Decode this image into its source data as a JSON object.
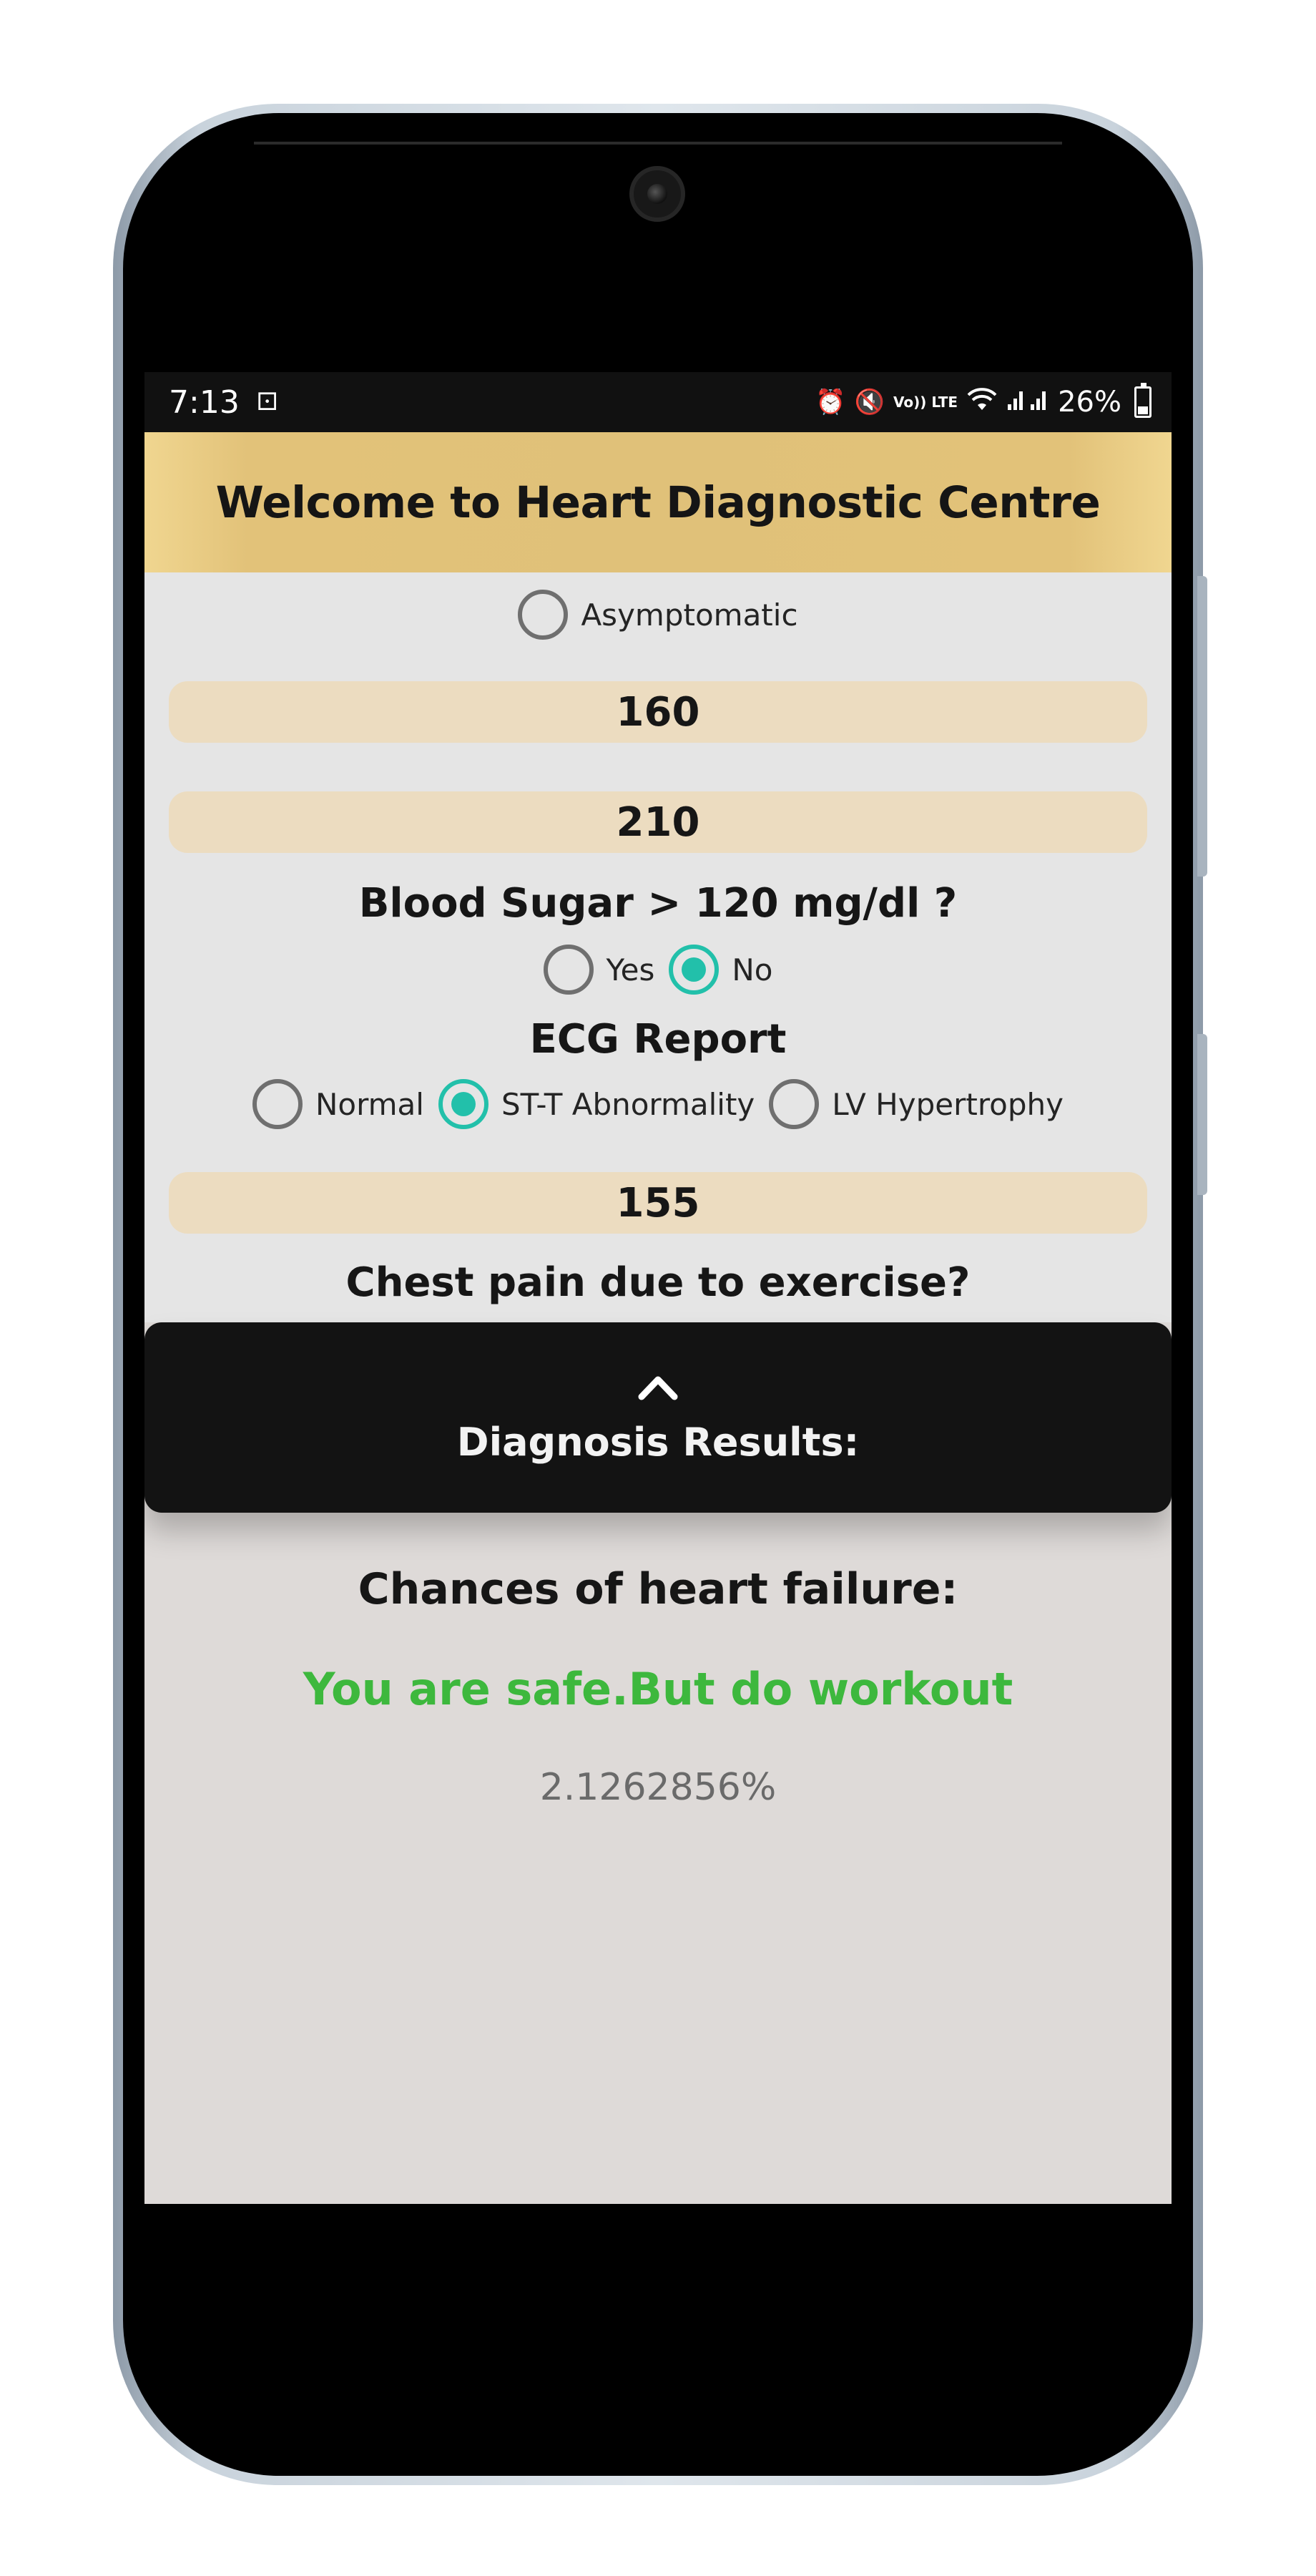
{
  "status_bar": {
    "time": "7:13",
    "battery": "26%",
    "volte": "Vo)) LTE",
    "icons": [
      "link-icon",
      "alarm-icon",
      "mute-icon",
      "wifi-icon",
      "signal-icon",
      "battery-icon"
    ]
  },
  "header": {
    "title": "Welcome to Heart Diagnostic Centre",
    "color": "#e0c179"
  },
  "form": {
    "chest_pain_option": {
      "label": "Asymptomatic",
      "checked": false
    },
    "field_1_value": "160",
    "field_2_value": "210",
    "blood_sugar": {
      "question": "Blood Sugar > 120 mg/dl ?",
      "options": [
        {
          "label": "Yes",
          "checked": false
        },
        {
          "label": "No",
          "checked": true
        }
      ]
    },
    "ecg": {
      "question": "ECG Report",
      "options": [
        {
          "label": "Normal",
          "checked": false
        },
        {
          "label": "ST-T Abnormality",
          "checked": true
        },
        {
          "label": "LV Hypertrophy",
          "checked": false
        }
      ]
    },
    "field_3_value": "155",
    "exercise_question": "Chest pain due to exercise?"
  },
  "results": {
    "sheet_title": "Diagnosis Results:",
    "heading": "Chances of heart failure:",
    "message": "You are safe.But do workout",
    "value": "2.1262856%",
    "message_color": "#3db83d",
    "accent_color": "#22c0aa"
  }
}
